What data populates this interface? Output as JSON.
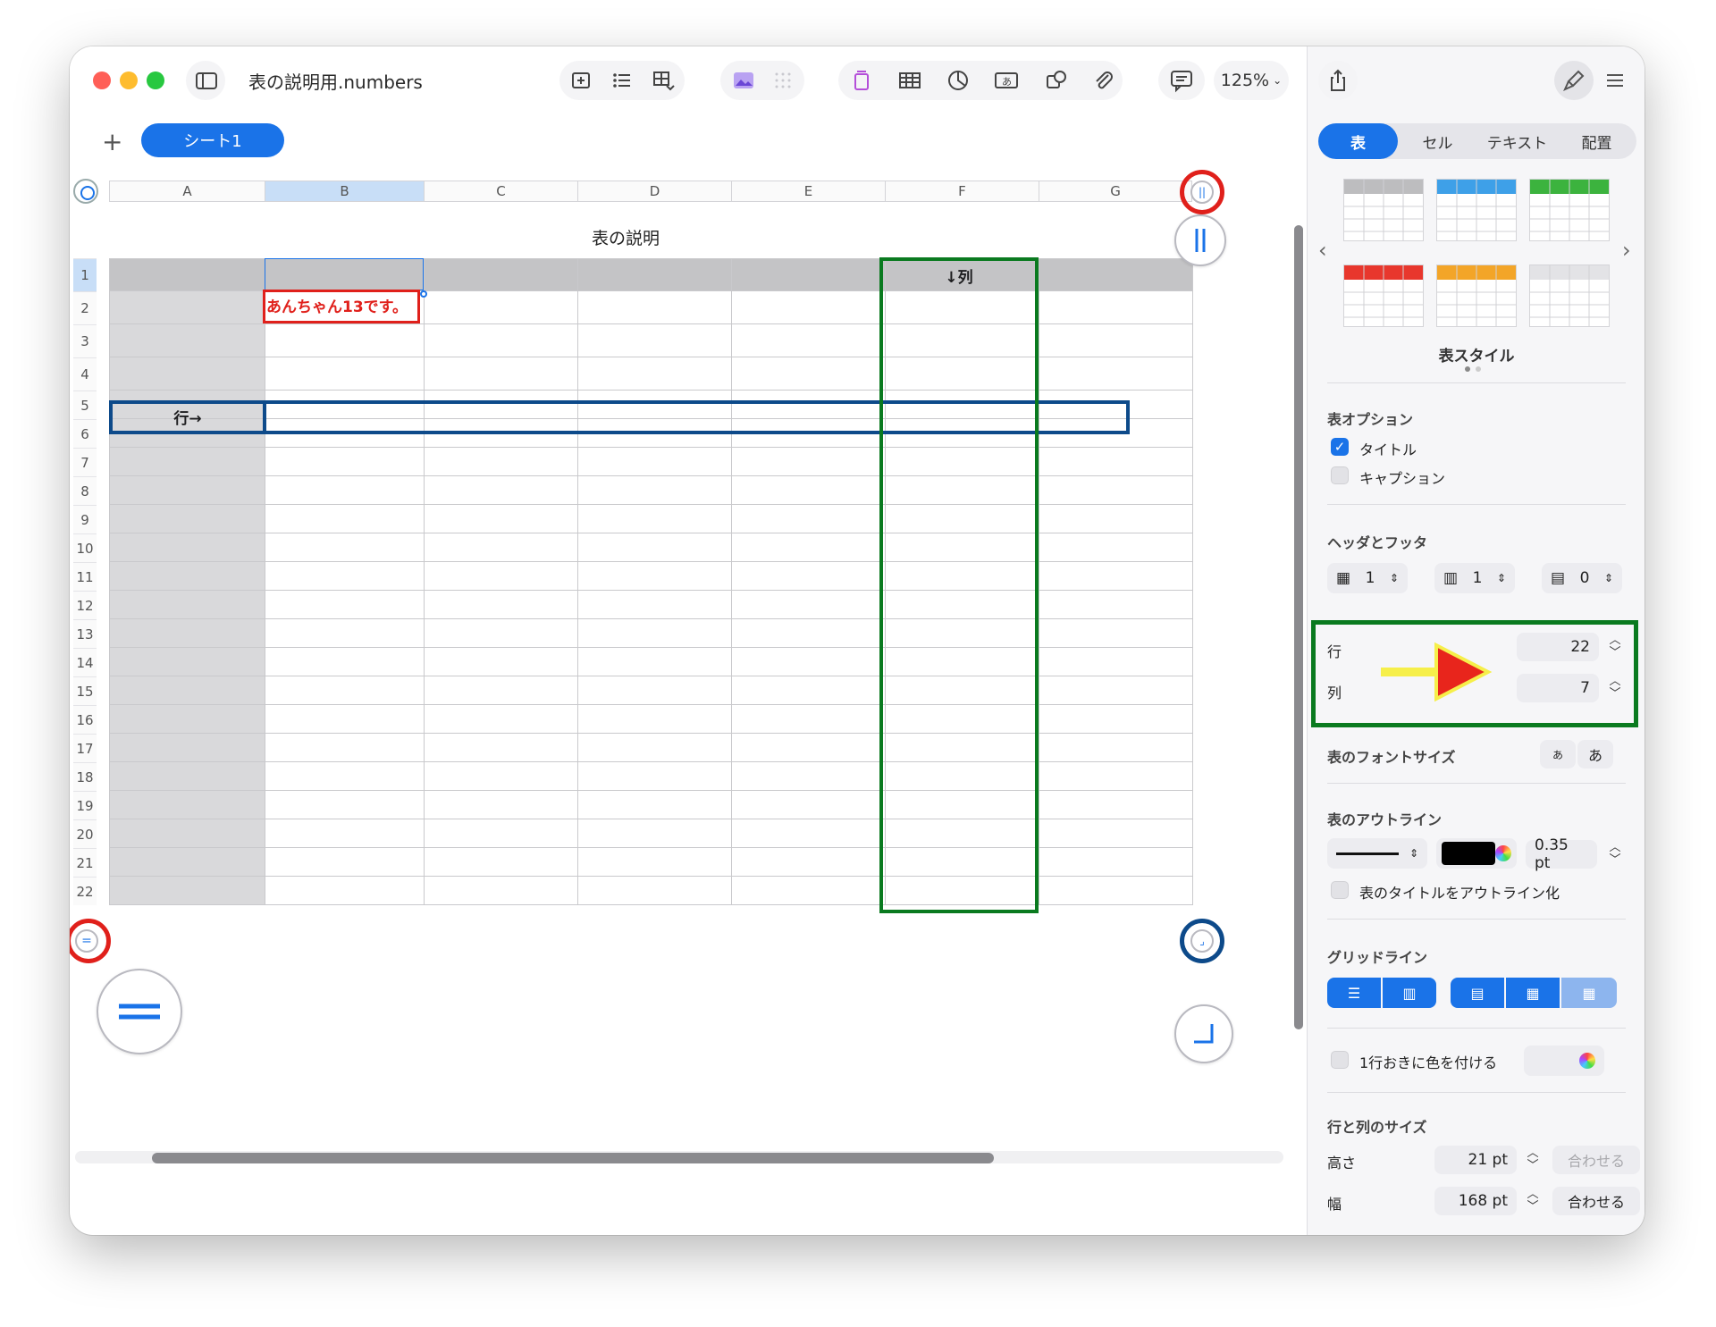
{
  "window": {
    "title": "表の説明用.numbers",
    "zoom": "125%"
  },
  "sheets": {
    "add_label": "+",
    "tabs": [
      "シート1"
    ]
  },
  "table": {
    "title": "表の説明",
    "columns": [
      "A",
      "B",
      "C",
      "D",
      "E",
      "F",
      "G"
    ],
    "rows": [
      "1",
      "2",
      "3",
      "4",
      "5",
      "6",
      "7",
      "8",
      "9",
      "10",
      "11",
      "12",
      "13",
      "14",
      "15",
      "16",
      "17",
      "18",
      "19",
      "20",
      "21",
      "22"
    ],
    "selected_column": "B",
    "selected_row": "1",
    "cell_b2": "あんちゃん13です。",
    "row_label": "行→",
    "column_label": "↓列"
  },
  "inspector": {
    "tabs": [
      "表",
      "セル",
      "テキスト",
      "配置"
    ],
    "active_tab": "表",
    "styles_label": "表スタイル",
    "style_colors": [
      "#bdbdbf",
      "#3ea0e8",
      "#3cb33e",
      "#e8372d",
      "#f3a528",
      "#e3e3e6"
    ],
    "options_label": "表オプション",
    "opt_title": "タイトル",
    "opt_title_checked": true,
    "opt_caption": "キャプション",
    "opt_caption_checked": false,
    "header_footer_label": "ヘッダとフッタ",
    "header_rows": "1",
    "header_cols": "1",
    "footer_rows": "0",
    "rows_label": "行",
    "rows_value": "22",
    "cols_label": "列",
    "cols_value": "7",
    "font_size_label": "表のフォントサイズ",
    "font_small": "あ",
    "font_large": "あ",
    "outline_label": "表のアウトライン",
    "outline_width": "0.35 pt",
    "outline_color": "#000000",
    "outline_title_label": "表のタイトルをアウトライン化",
    "gridlines_label": "グリッドライン",
    "alternate_rows_label": "1行おきに色を付ける",
    "row_col_size_label": "行と列のサイズ",
    "height_label": "高さ",
    "height_value": "21 pt",
    "width_label": "幅",
    "width_value": "168 pt",
    "fit_label": "合わせる",
    "fit_label_2": "合わせる"
  },
  "colors": {
    "accent": "#1a73e8",
    "annotation_red": "#e0201b",
    "annotation_green": "#0a7a1f",
    "annotation_blue": "#0d4a8a"
  }
}
